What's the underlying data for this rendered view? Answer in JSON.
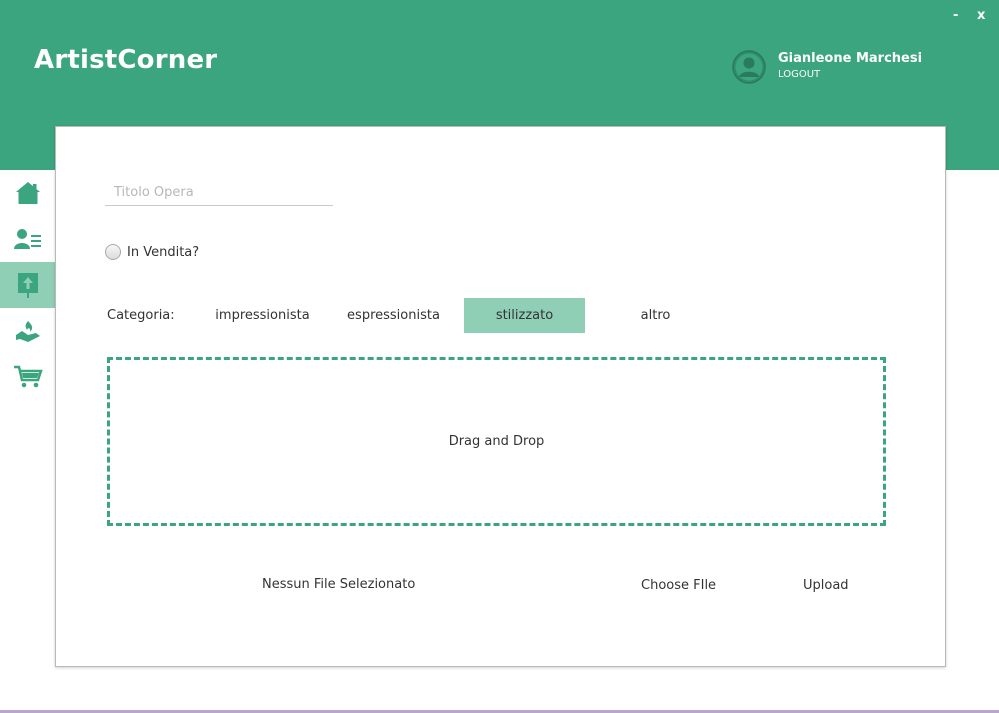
{
  "header": {
    "app_title": "ArtistCorner",
    "window_controls": {
      "minimize": "-",
      "close": "x"
    },
    "user": {
      "name": "Gianleone Marchesi",
      "logout": "LOGOUT",
      "avatar_icon": "user-avatar-icon"
    }
  },
  "sidebar": {
    "items": [
      {
        "id": "home",
        "icon": "home-icon",
        "active": false
      },
      {
        "id": "profile",
        "icon": "user-list-icon",
        "active": false
      },
      {
        "id": "upload",
        "icon": "upload-icon",
        "active": true
      },
      {
        "id": "donate",
        "icon": "hand-flame-icon",
        "active": false
      },
      {
        "id": "cart",
        "icon": "cart-icon",
        "active": false
      }
    ]
  },
  "form": {
    "title_placeholder": "Titolo Opera",
    "title_value": "",
    "for_sale_label": "In Vendita?",
    "for_sale_checked": false,
    "category_label": "Categoria:",
    "categories": [
      "impressionista",
      "espressionista",
      "stilizzato",
      "altro"
    ],
    "selected_category": "stilizzato",
    "dropzone_text": "Drag and Drop",
    "file_status": "Nessun File Selezionato",
    "choose_file_label": "Choose FIle",
    "upload_label": "Upload"
  },
  "colors": {
    "accent": "#3aa57f",
    "accent_light": "#8fcfb6",
    "background": "#ffffff"
  }
}
